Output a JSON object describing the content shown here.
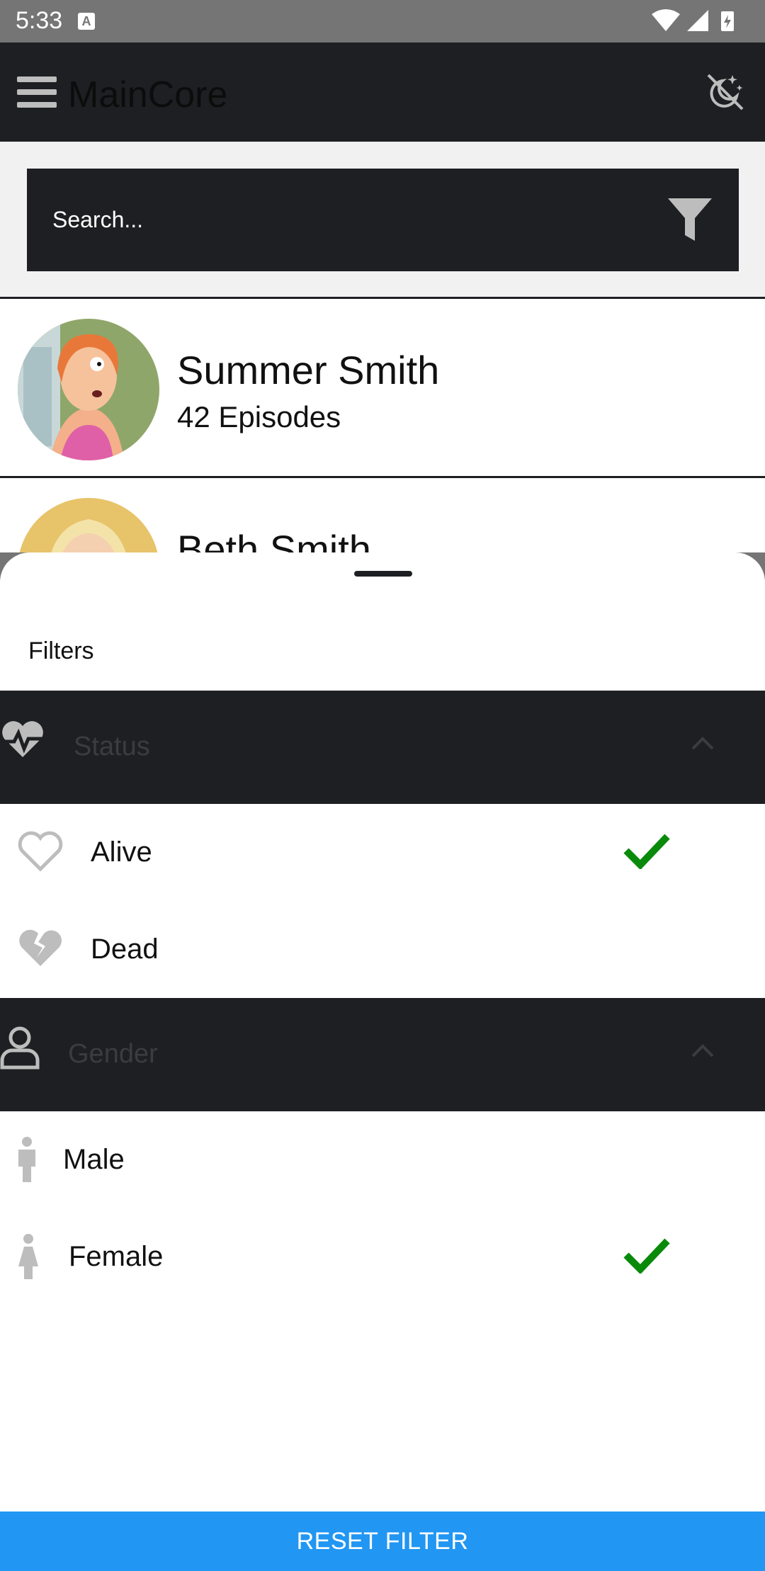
{
  "status_bar": {
    "time": "5:33",
    "notification_icon": "A"
  },
  "app_bar": {
    "title": "MainCore"
  },
  "search": {
    "placeholder": "Search..."
  },
  "characters": [
    {
      "name": "Summer Smith",
      "episodes": "42 Episodes"
    },
    {
      "name": "Beth Smith",
      "episodes": ""
    }
  ],
  "filters": {
    "title": "Filters",
    "status": {
      "label": "Status",
      "options": [
        {
          "label": "Alive",
          "selected": true
        },
        {
          "label": "Dead",
          "selected": false
        }
      ]
    },
    "gender": {
      "label": "Gender",
      "options": [
        {
          "label": "Male",
          "selected": false
        },
        {
          "label": "Female",
          "selected": true
        }
      ]
    },
    "reset_label": "RESET FILTER"
  },
  "colors": {
    "app_bar": "#1e1f22",
    "accent": "#2196f3",
    "check": "#0a8a0a",
    "icon_gray": "#bdbdbd"
  }
}
